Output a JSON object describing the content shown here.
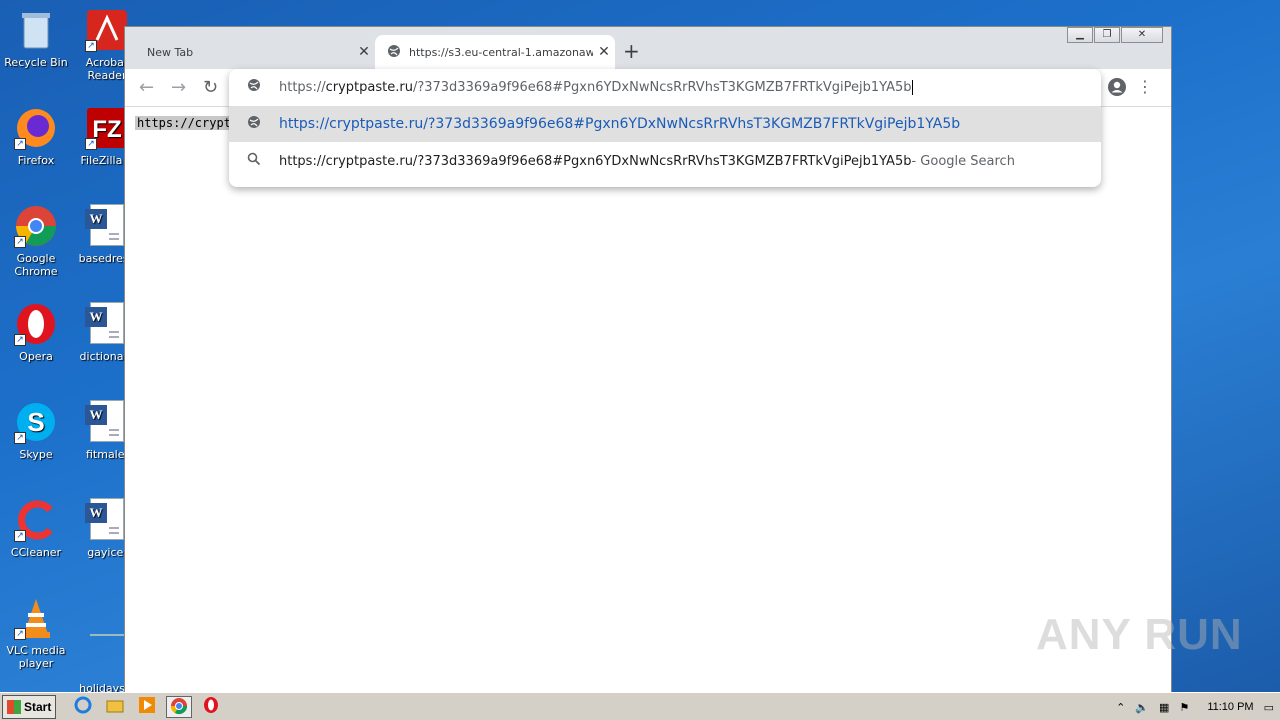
{
  "desktop": {
    "icons": [
      {
        "label": "Recycle Bin",
        "icon": "recycle-bin-icon"
      },
      {
        "label": "Acrobat Reader",
        "icon": "acrobat-icon"
      },
      {
        "label": "Firefox",
        "icon": "firefox-icon"
      },
      {
        "label": "FileZilla C",
        "icon": "filezilla-icon"
      },
      {
        "label": "Google Chrome",
        "icon": "chrome-icon"
      },
      {
        "label": "basedrese",
        "icon": "word-doc-icon"
      },
      {
        "label": "Opera",
        "icon": "opera-icon"
      },
      {
        "label": "dictionary",
        "icon": "word-doc-icon"
      },
      {
        "label": "Skype",
        "icon": "skype-icon"
      },
      {
        "label": "fitmale.",
        "icon": "word-doc-icon"
      },
      {
        "label": "CCleaner",
        "icon": "ccleaner-icon"
      },
      {
        "label": "gayice.",
        "icon": "word-doc-icon"
      },
      {
        "label": "VLC media player",
        "icon": "vlc-icon"
      },
      {
        "label": "holidaysin",
        "icon": "file-icon"
      }
    ]
  },
  "browser": {
    "tabs": [
      {
        "title": "New Tab",
        "active": false
      },
      {
        "title": "https://s3.eu-central-1.amazonaws",
        "active": true
      }
    ],
    "omnibox": {
      "prefix": "https://",
      "host": "cryptpaste.ru",
      "rest": "/?373d3369a9f96e68#Pgxn6YDxNwNcsRrRVhsT3KGMZB7FRTkVgiPejb1YA5b"
    },
    "suggestions": [
      {
        "text": "https://cryptpaste.ru/?373d3369a9f96e68#Pgxn6YDxNwNcsRrRVhsT3KGMZB7FRTkVgiPejb1YA5b",
        "suffix": ""
      },
      {
        "text": "https://cryptpaste.ru/?373d3369a9f96e68#Pgxn6YDxNwNcsRrRVhsT3KGMZB7FRTkVgiPejb1YA5b",
        "suffix": " - Google Search"
      }
    ],
    "page_text": "https://cryptp"
  },
  "watermark": "ANY RUN",
  "taskbar": {
    "start_label": "Start",
    "clock": "11:10 PM"
  },
  "colors": {
    "suggestion_link": "#1a5bb8",
    "tab_strip": "#dee1e6",
    "taskbar": "#d4d0c8"
  }
}
